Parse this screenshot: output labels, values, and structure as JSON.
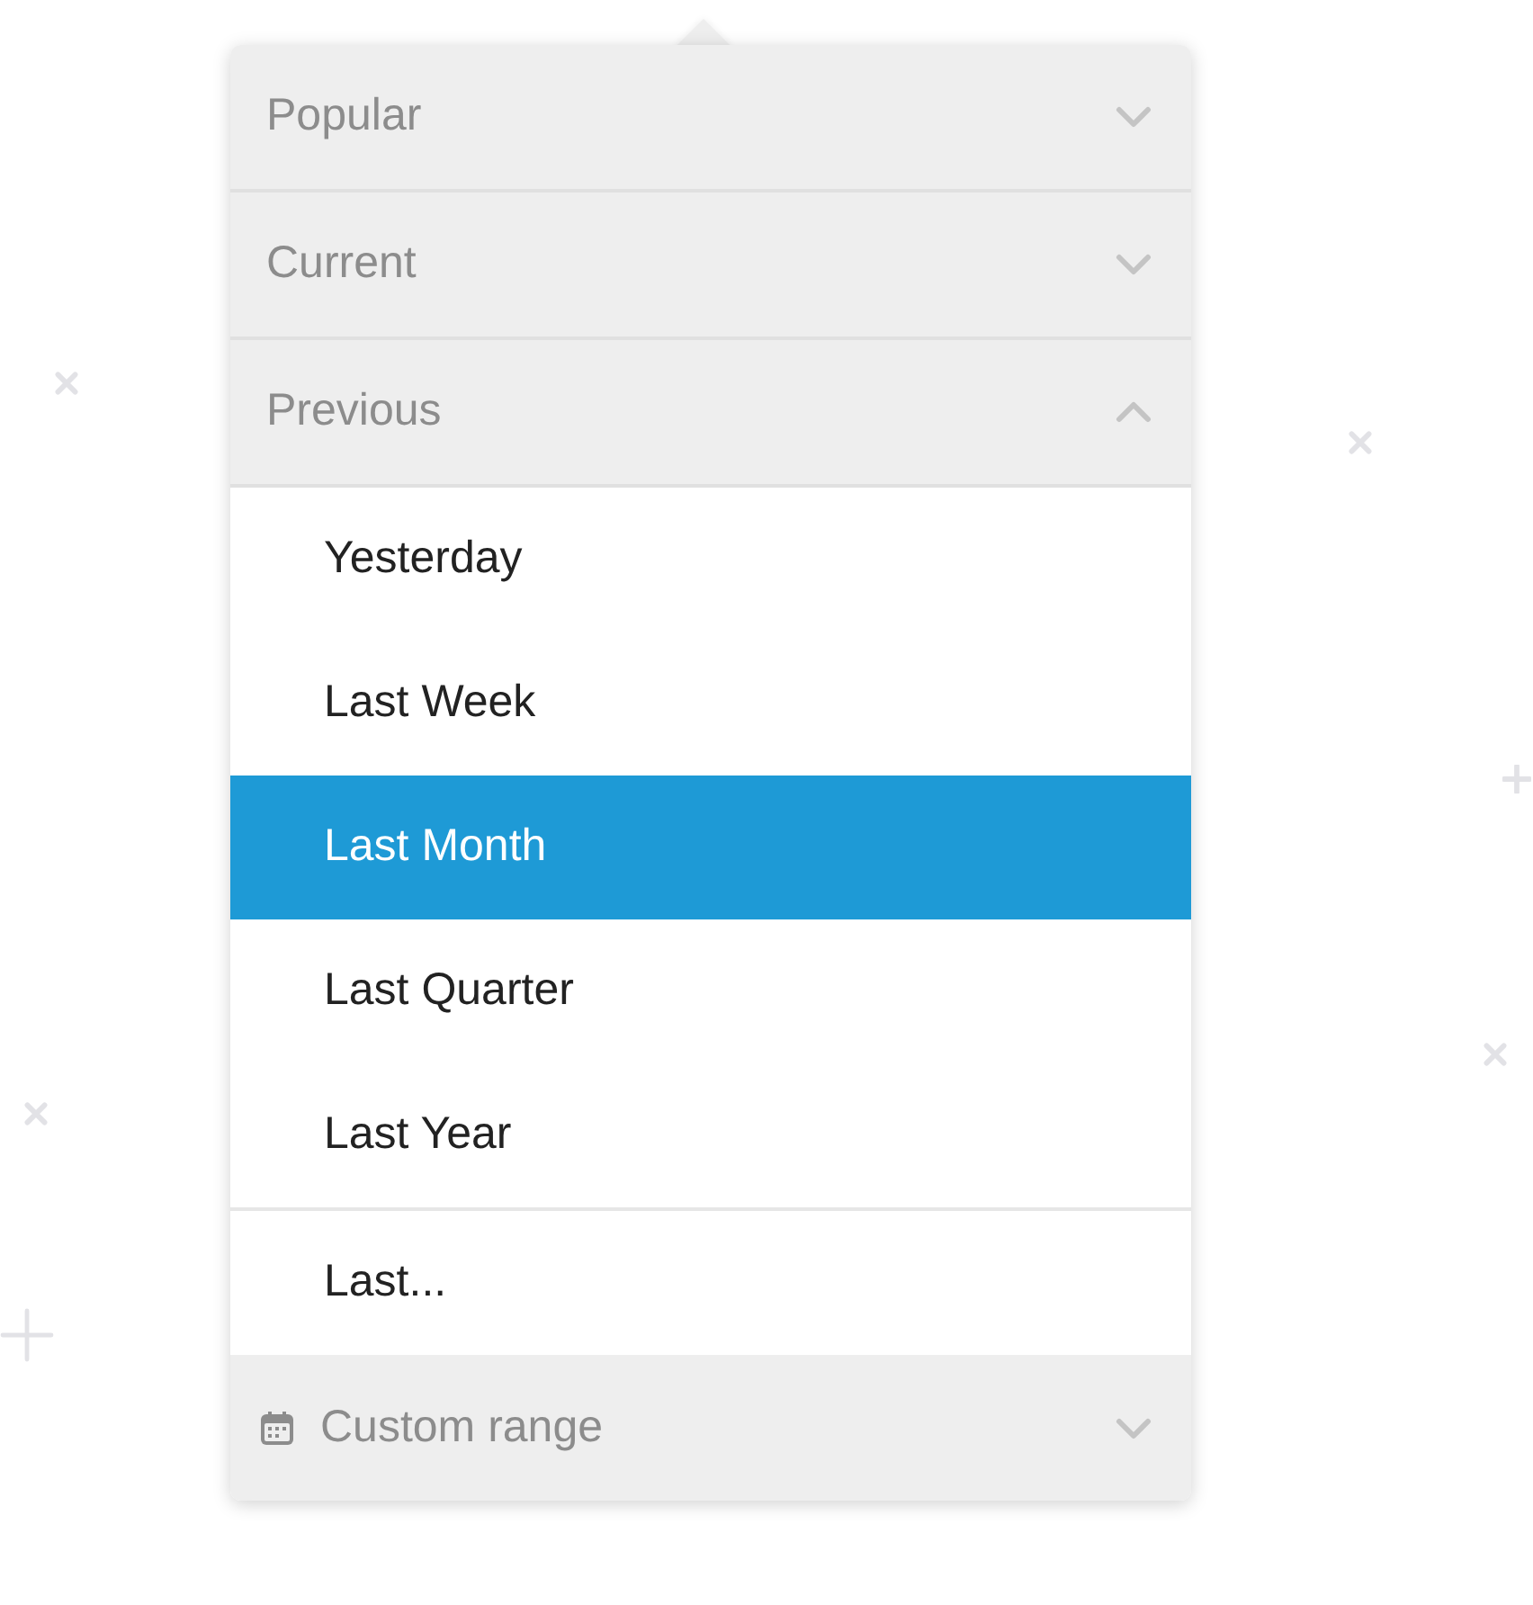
{
  "sections": [
    {
      "label": "Popular",
      "expanded": false
    },
    {
      "label": "Current",
      "expanded": false
    },
    {
      "label": "Previous",
      "expanded": true,
      "items": [
        {
          "label": "Yesterday",
          "kind": "option",
          "selected": false
        },
        {
          "label": "Last Week",
          "kind": "option",
          "selected": false
        },
        {
          "label": "Last Month",
          "kind": "option",
          "selected": true
        },
        {
          "label": "Last Quarter",
          "kind": "option",
          "selected": false
        },
        {
          "label": "Last Year",
          "kind": "option",
          "selected": false
        },
        {
          "label": "Last...",
          "kind": "custom",
          "selected": false
        }
      ]
    }
  ],
  "custom_range": {
    "label": "Custom range",
    "expanded": false
  }
}
